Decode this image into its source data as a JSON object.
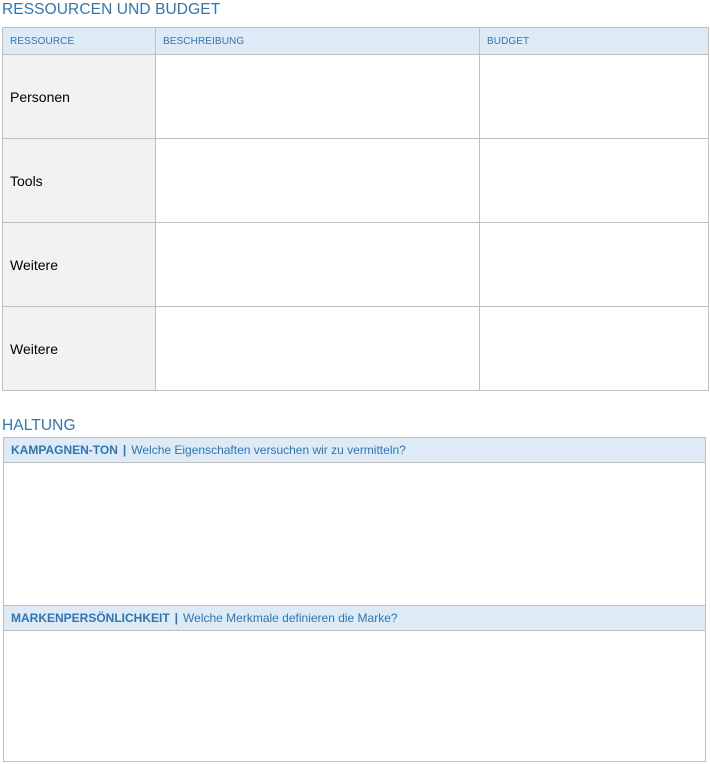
{
  "resources": {
    "title": "RESSOURCEN UND BUDGET",
    "columns": [
      "RESSOURCE",
      "BESCHREIBUNG",
      "BUDGET"
    ],
    "rows": [
      {
        "label": "Personen",
        "description": "",
        "budget": ""
      },
      {
        "label": "Tools",
        "description": "",
        "budget": ""
      },
      {
        "label": "Weitere",
        "description": "",
        "budget": ""
      },
      {
        "label": "Weitere",
        "description": "",
        "budget": ""
      }
    ]
  },
  "attitude": {
    "title": "HALTUNG",
    "campaign_tone": {
      "label": "KAMPAGNEN-TON",
      "separator": "|",
      "question": "Welche Eigenschaften versuchen wir zu vermitteln?",
      "content": ""
    },
    "brand_personality": {
      "label": "MARKENPERSÖNLICHKEIT",
      "separator": "|",
      "question": "Welche Merkmale definieren die Marke?",
      "content": ""
    }
  },
  "colors": {
    "accent": "#2e75b6",
    "header_fill": "#deeaf6",
    "label_fill": "#f2f2f2",
    "border": "#bfbfbf"
  }
}
